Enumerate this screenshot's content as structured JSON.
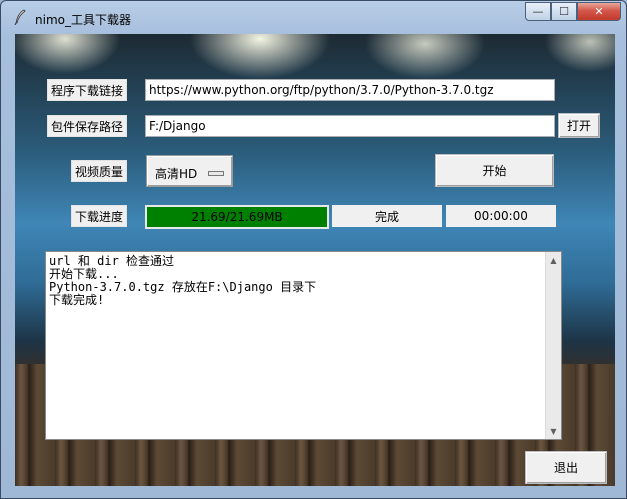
{
  "window": {
    "title": "nimo_工具下载器",
    "minimize_glyph": "—",
    "maximize_glyph": "☐",
    "close_glyph": "✕"
  },
  "form": {
    "url_label": "程序下载链接",
    "url_value": "https://www.python.org/ftp/python/3.7.0/Python-3.7.0.tgz",
    "path_label": "包件保存路径",
    "path_value": "F:/Django",
    "open_button": "打开",
    "quality_label": "视频质量",
    "quality_value": "高清HD",
    "start_button": "开始",
    "progress_label": "下载进度",
    "progress_text": "21.69/21.69MB",
    "progress_fraction": 1.0,
    "status_text": "完成",
    "time_text": "00:00:00"
  },
  "log": {
    "lines": [
      "url 和 dir 检查通过",
      "开始下载...",
      "Python-3.7.0.tgz 存放在F:\\Django 目录下",
      "下载完成!"
    ]
  },
  "exit_button": "退出",
  "icons": {
    "app": "feather-pen-icon",
    "scroll_up": "chevron-up-icon",
    "scroll_down": "chevron-down-icon"
  },
  "colors": {
    "progress_fill": "#008000",
    "close_button": "#c9483a"
  }
}
